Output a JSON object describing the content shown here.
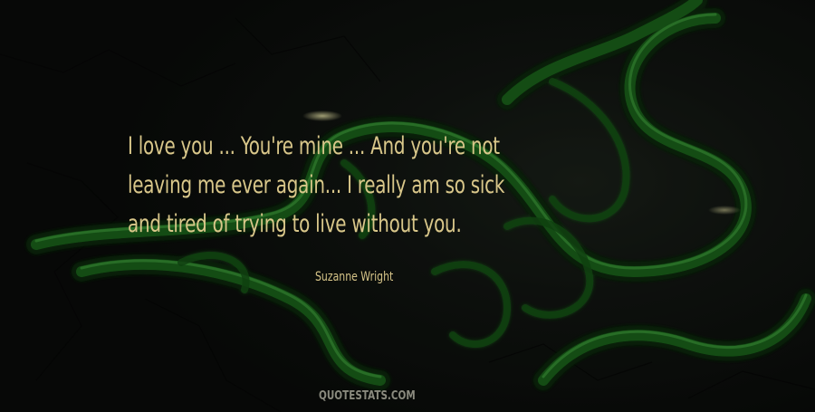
{
  "quote": {
    "lines": [
      "I love you ... You're mine ... And you're not",
      "leaving me ever again... I really am so sick",
      "and tired of trying to live without you."
    ]
  },
  "author": "Suzanne Wright",
  "watermark": "QUOTESTATS.COM",
  "colors": {
    "text": "#d9c78a",
    "background": "#121612",
    "logo_green": "#1d6b1f"
  },
  "background_art": "green triple-snake logo embossed over dark cracked stone"
}
